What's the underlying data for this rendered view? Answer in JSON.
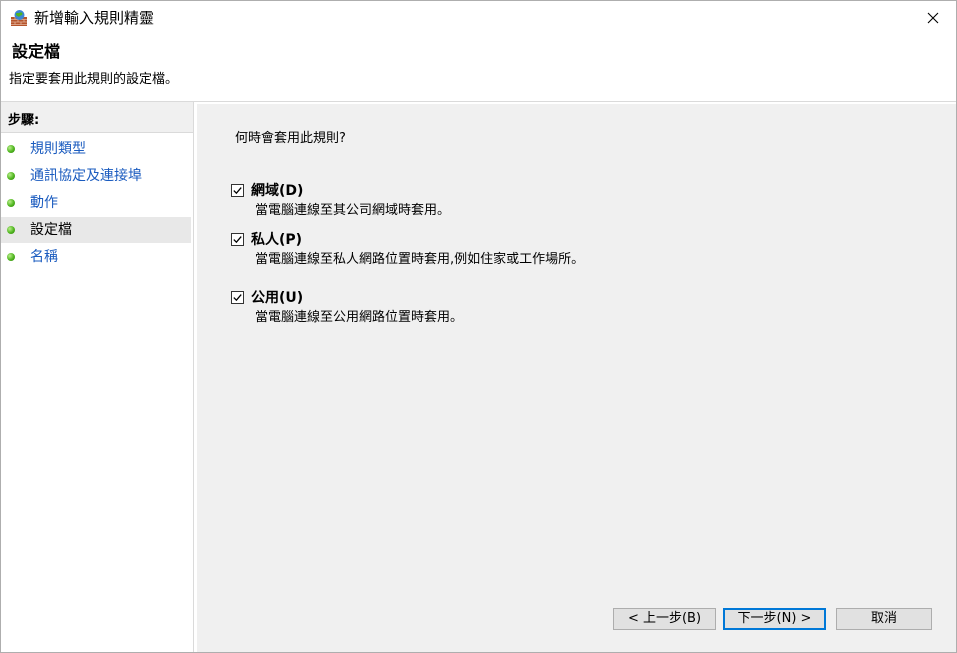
{
  "window": {
    "title": "新增輸入規則精靈"
  },
  "header": {
    "title": "設定檔",
    "description": "指定要套用此規則的設定檔。"
  },
  "sidebar": {
    "title": "步驟:",
    "items": [
      {
        "label": "規則類型"
      },
      {
        "label": "通訊協定及連接埠"
      },
      {
        "label": "動作"
      },
      {
        "label": "設定檔"
      },
      {
        "label": "名稱"
      }
    ]
  },
  "main": {
    "question": "何時會套用此規則?",
    "options": [
      {
        "label": "網域(D)",
        "description": "當電腦連線至其公司網域時套用。",
        "checked": true
      },
      {
        "label": "私人(P)",
        "description": "當電腦連線至私人網路位置時套用,例如住家或工作場所。",
        "checked": true
      },
      {
        "label": "公用(U)",
        "description": "當電腦連線至公用網路位置時套用。",
        "checked": true
      }
    ]
  },
  "buttons": {
    "back": "< 上一步(B)",
    "next": "下一步(N) >",
    "cancel": "取消"
  },
  "colors": {
    "link": "#1a5bbf",
    "step_dot": "#4fb51f",
    "content_bg": "#f0f0f0",
    "default_border": "#0078d7"
  }
}
